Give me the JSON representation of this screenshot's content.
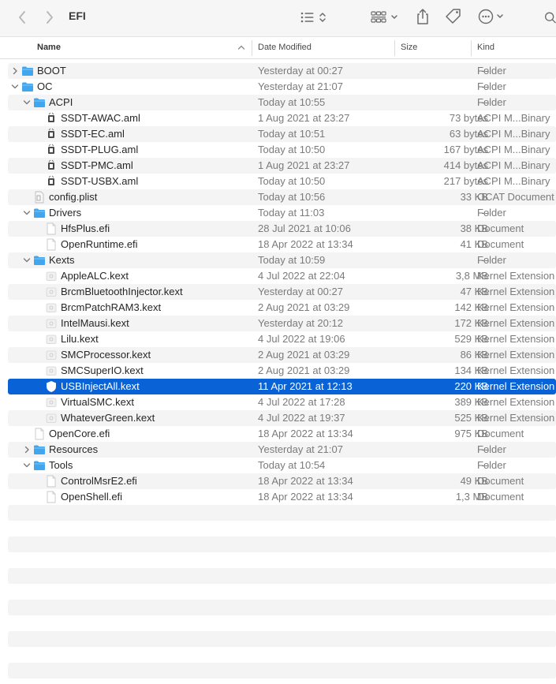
{
  "window": {
    "title": "EFI"
  },
  "toolbar": {
    "back_icon": "chevron-left-icon",
    "forward_icon": "chevron-right-icon",
    "view_list_icon": "list-view-icon",
    "group_icon": "group-grid-icon",
    "share_icon": "share-icon",
    "tag_icon": "tag-icon",
    "more_icon": "ellipsis-icon",
    "search_icon": "search-icon"
  },
  "columns": {
    "name": "Name",
    "date": "Date Modified",
    "size": "Size",
    "kind": "Kind"
  },
  "colors": {
    "selection": "#0a63d6",
    "folder": "#3fa6ef",
    "stripe": "#f4f4f5"
  },
  "rows": [
    {
      "name": "BOOT",
      "level": 0,
      "disclosure": "collapsed",
      "icon": "folder-icon",
      "date": "Yesterday at 00:27",
      "size": "--",
      "kind": "Folder"
    },
    {
      "name": "OC",
      "level": 0,
      "disclosure": "expanded",
      "icon": "folder-icon",
      "date": "Yesterday at 21:07",
      "size": "--",
      "kind": "Folder"
    },
    {
      "name": "ACPI",
      "level": 1,
      "disclosure": "expanded",
      "icon": "folder-icon",
      "date": "Today at 10:55",
      "size": "--",
      "kind": "Folder"
    },
    {
      "name": "SSDT-AWAC.aml",
      "level": 2,
      "disclosure": "none",
      "icon": "aml-file-icon",
      "date": "1 Aug 2021 at 23:27",
      "size": "73 bytes",
      "kind": "ACPI M...Binary"
    },
    {
      "name": "SSDT-EC.aml",
      "level": 2,
      "disclosure": "none",
      "icon": "aml-file-icon",
      "date": "Today at 10:51",
      "size": "63 bytes",
      "kind": "ACPI M...Binary"
    },
    {
      "name": "SSDT-PLUG.aml",
      "level": 2,
      "disclosure": "none",
      "icon": "aml-file-icon",
      "date": "Today at 10:50",
      "size": "167 bytes",
      "kind": "ACPI M...Binary"
    },
    {
      "name": "SSDT-PMC.aml",
      "level": 2,
      "disclosure": "none",
      "icon": "aml-file-icon",
      "date": "1 Aug 2021 at 23:27",
      "size": "414 bytes",
      "kind": "ACPI M...Binary"
    },
    {
      "name": "SSDT-USBX.aml",
      "level": 2,
      "disclosure": "none",
      "icon": "aml-file-icon",
      "date": "Today at 10:50",
      "size": "217 bytes",
      "kind": "ACPI M...Binary"
    },
    {
      "name": "config.plist",
      "level": 1,
      "disclosure": "none",
      "icon": "plist-file-icon",
      "date": "Today at 10:56",
      "size": "33 KB",
      "kind": "OCAT Document"
    },
    {
      "name": "Drivers",
      "level": 1,
      "disclosure": "expanded",
      "icon": "folder-icon",
      "date": "Today at 11:03",
      "size": "--",
      "kind": "Folder"
    },
    {
      "name": "HfsPlus.efi",
      "level": 2,
      "disclosure": "none",
      "icon": "document-icon",
      "date": "28 Jul 2021 at 10:06",
      "size": "38 KB",
      "kind": "Document"
    },
    {
      "name": "OpenRuntime.efi",
      "level": 2,
      "disclosure": "none",
      "icon": "document-icon",
      "date": "18 Apr 2022 at 13:34",
      "size": "41 KB",
      "kind": "Document"
    },
    {
      "name": "Kexts",
      "level": 1,
      "disclosure": "expanded",
      "icon": "folder-icon",
      "date": "Today at 10:59",
      "size": "--",
      "kind": "Folder"
    },
    {
      "name": "AppleALC.kext",
      "level": 2,
      "disclosure": "none",
      "icon": "kext-icon",
      "date": "4 Jul 2022 at 22:04",
      "size": "3,8 MB",
      "kind": "Kernel Extension"
    },
    {
      "name": "BrcmBluetoothInjector.kext",
      "level": 2,
      "disclosure": "none",
      "icon": "kext-icon",
      "date": "Yesterday at 00:27",
      "size": "47 KB",
      "kind": "Kernel Extension"
    },
    {
      "name": "BrcmPatchRAM3.kext",
      "level": 2,
      "disclosure": "none",
      "icon": "kext-icon",
      "date": "2 Aug 2021 at 03:29",
      "size": "142 KB",
      "kind": "Kernel Extension"
    },
    {
      "name": "IntelMausi.kext",
      "level": 2,
      "disclosure": "none",
      "icon": "kext-icon",
      "date": "Yesterday at 20:12",
      "size": "172 KB",
      "kind": "Kernel Extension"
    },
    {
      "name": "Lilu.kext",
      "level": 2,
      "disclosure": "none",
      "icon": "kext-icon",
      "date": "4 Jul 2022 at 19:06",
      "size": "529 KB",
      "kind": "Kernel Extension"
    },
    {
      "name": "SMCProcessor.kext",
      "level": 2,
      "disclosure": "none",
      "icon": "kext-icon",
      "date": "2 Aug 2021 at 03:29",
      "size": "86 KB",
      "kind": "Kernel Extension"
    },
    {
      "name": "SMCSuperIO.kext",
      "level": 2,
      "disclosure": "none",
      "icon": "kext-icon",
      "date": "2 Aug 2021 at 03:29",
      "size": "134 KB",
      "kind": "Kernel Extension"
    },
    {
      "name": "USBInjectAll.kext",
      "level": 2,
      "disclosure": "none",
      "icon": "kext-icon",
      "date": "11 Apr 2021 at 12:13",
      "size": "220 KB",
      "kind": "Kernel Extension",
      "selected": true
    },
    {
      "name": "VirtualSMC.kext",
      "level": 2,
      "disclosure": "none",
      "icon": "kext-icon",
      "date": "4 Jul 2022 at 17:28",
      "size": "389 KB",
      "kind": "Kernel Extension"
    },
    {
      "name": "WhateverGreen.kext",
      "level": 2,
      "disclosure": "none",
      "icon": "kext-icon",
      "date": "4 Jul 2022 at 19:37",
      "size": "525 KB",
      "kind": "Kernel Extension"
    },
    {
      "name": "OpenCore.efi",
      "level": 1,
      "disclosure": "none",
      "icon": "document-icon",
      "date": "18 Apr 2022 at 13:34",
      "size": "975 KB",
      "kind": "Document"
    },
    {
      "name": "Resources",
      "level": 1,
      "disclosure": "collapsed",
      "icon": "folder-icon",
      "date": "Yesterday at 21:07",
      "size": "--",
      "kind": "Folder"
    },
    {
      "name": "Tools",
      "level": 1,
      "disclosure": "expanded",
      "icon": "folder-icon",
      "date": "Today at 10:54",
      "size": "--",
      "kind": "Folder"
    },
    {
      "name": "ControlMsrE2.efi",
      "level": 2,
      "disclosure": "none",
      "icon": "document-icon",
      "date": "18 Apr 2022 at 13:34",
      "size": "49 KB",
      "kind": "Document"
    },
    {
      "name": "OpenShell.efi",
      "level": 2,
      "disclosure": "none",
      "icon": "document-icon",
      "date": "18 Apr 2022 at 13:34",
      "size": "1,3 MB",
      "kind": "Document"
    }
  ]
}
